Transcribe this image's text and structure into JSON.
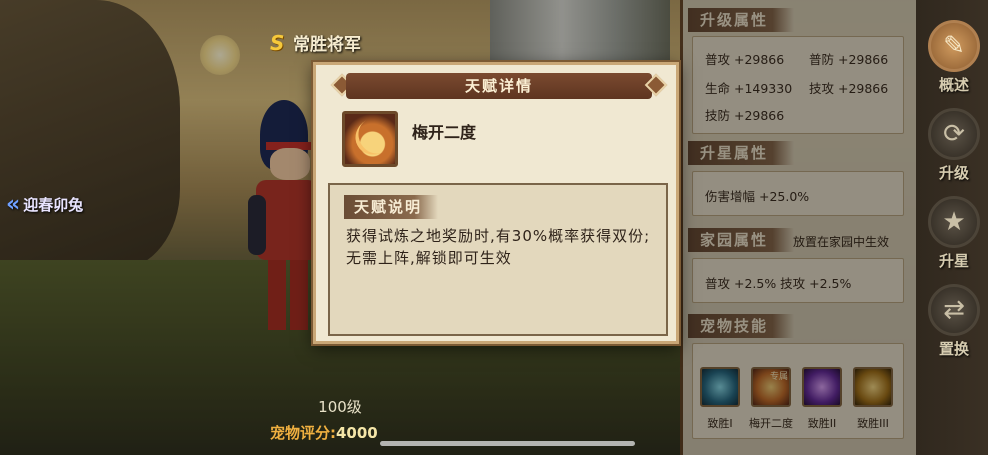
{
  "hero": {
    "title": "常胜将军",
    "rank_letter": "S",
    "level": "100级",
    "score_label": "宠物评分:",
    "score_value": "4000"
  },
  "left_nav": {
    "label": "迎春卯兔"
  },
  "dialog": {
    "title": "天赋详情",
    "talent_name": "梅开二度",
    "desc_label": "天赋说明",
    "desc_text": "获得试炼之地奖励时,有30%概率获得双份;无需上阵,解锁即可生效"
  },
  "panel": {
    "upgrade": {
      "title": "升级属性",
      "stats": [
        "普攻 +29866",
        "普防 +29866",
        "生命 +149330",
        "技攻 +29866",
        "技防 +29866"
      ]
    },
    "star": {
      "title": "升星属性",
      "stats": [
        "伤害增幅 +25.0%"
      ]
    },
    "home": {
      "title": "家园属性",
      "note": "放置在家园中生效",
      "stats": [
        "普攻 +2.5% 技攻 +2.5%"
      ]
    },
    "skills": {
      "title": "宠物技能",
      "items": [
        {
          "label": "致胜I",
          "badge": ""
        },
        {
          "label": "梅开二度",
          "badge": "专属"
        },
        {
          "label": "致胜II",
          "badge": ""
        },
        {
          "label": "致胜III",
          "badge": ""
        }
      ]
    }
  },
  "side_buttons": [
    {
      "label": "概述",
      "icon": "scroll-icon",
      "glyph": "✎",
      "active": true
    },
    {
      "label": "升级",
      "icon": "upgrade-icon",
      "glyph": "⟳",
      "active": false
    },
    {
      "label": "升星",
      "icon": "star-icon",
      "glyph": "★",
      "active": false
    },
    {
      "label": "置换",
      "icon": "swap-icon",
      "glyph": "⇄",
      "active": false
    }
  ],
  "colors": {
    "accent": "#6a4c35",
    "score": "#f0b040",
    "rank": "#f6c93b"
  }
}
